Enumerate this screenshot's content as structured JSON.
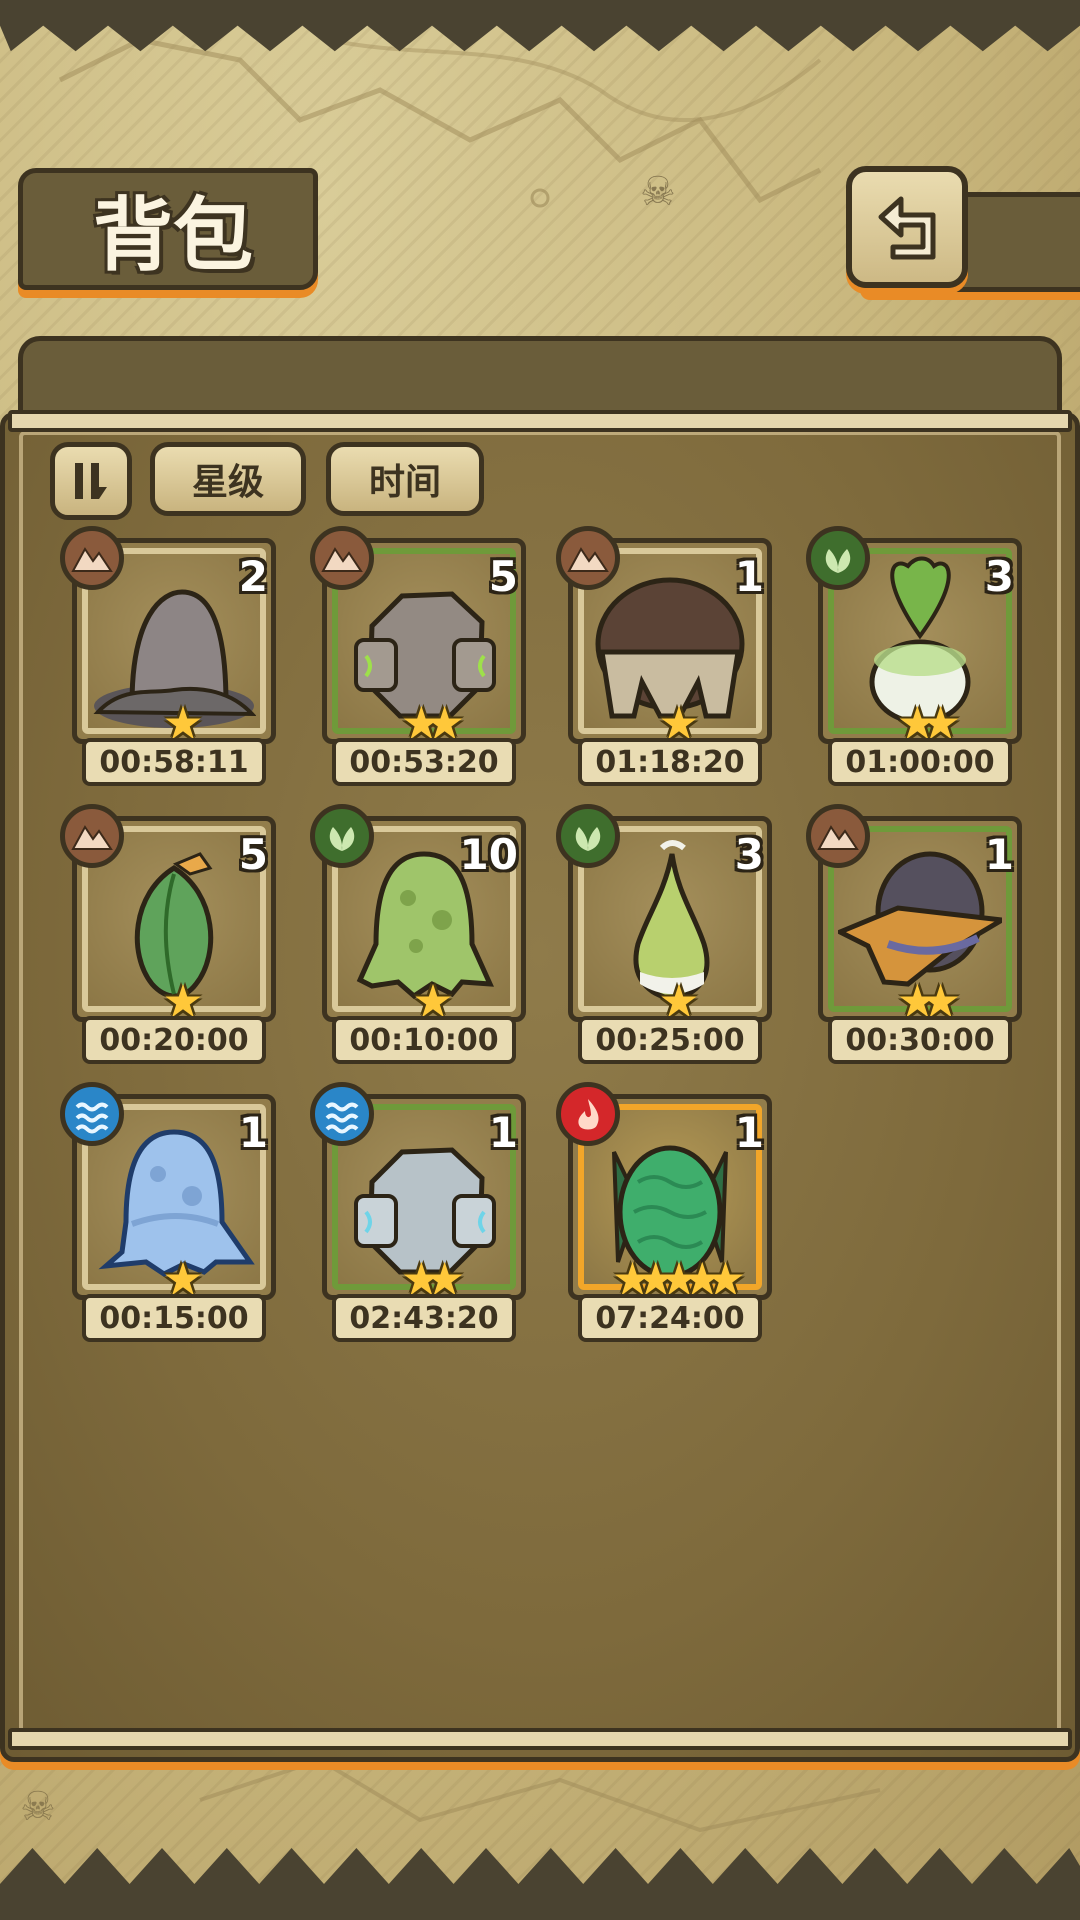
{
  "header": {
    "title": "背包"
  },
  "sort": {
    "star_label": "星级",
    "time_label": "时间"
  },
  "colors": {
    "element_earth": "#8a5a3c",
    "element_plant": "#3f6e2d",
    "element_water": "#2a86c8",
    "element_fire": "#d4272a",
    "frame_green": "#6f9a3a",
    "frame_orange": "#f2a629",
    "star": "#ffc83a"
  },
  "eggs": [
    {
      "name": "stone-mound-egg",
      "element": "earth",
      "count": "2",
      "stars": "★",
      "timer": "00:58:11",
      "frame": "plain"
    },
    {
      "name": "rock-armor-egg",
      "element": "earth",
      "count": "5",
      "stars": "★★",
      "timer": "00:53:20",
      "frame": "green"
    },
    {
      "name": "dark-dome-egg",
      "element": "earth",
      "count": "1",
      "stars": "★",
      "timer": "01:18:20",
      "frame": "plain"
    },
    {
      "name": "turnip-egg",
      "element": "plant",
      "count": "3",
      "stars": "★★",
      "timer": "01:00:00",
      "frame": "green"
    },
    {
      "name": "leaf-bud-egg",
      "element": "earth",
      "count": "5",
      "stars": "★",
      "timer": "00:20:00",
      "frame": "plain"
    },
    {
      "name": "slime-green-egg",
      "element": "plant",
      "count": "10",
      "stars": "★",
      "timer": "00:10:00",
      "frame": "plain"
    },
    {
      "name": "gourd-sprout-egg",
      "element": "plant",
      "count": "3",
      "stars": "★",
      "timer": "00:25:00",
      "frame": "plain"
    },
    {
      "name": "hat-egg",
      "element": "earth",
      "count": "1",
      "stars": "★★",
      "timer": "00:30:00",
      "frame": "green"
    },
    {
      "name": "slime-blue-egg",
      "element": "water",
      "count": "1",
      "stars": "★",
      "timer": "00:15:00",
      "frame": "plain"
    },
    {
      "name": "ice-armor-egg",
      "element": "water",
      "count": "1",
      "stars": "★★",
      "timer": "02:43:20",
      "frame": "green"
    },
    {
      "name": "dragon-egg",
      "element": "fire",
      "count": "1",
      "stars": "★★★★★",
      "timer": "07:24:00",
      "frame": "orange"
    }
  ]
}
